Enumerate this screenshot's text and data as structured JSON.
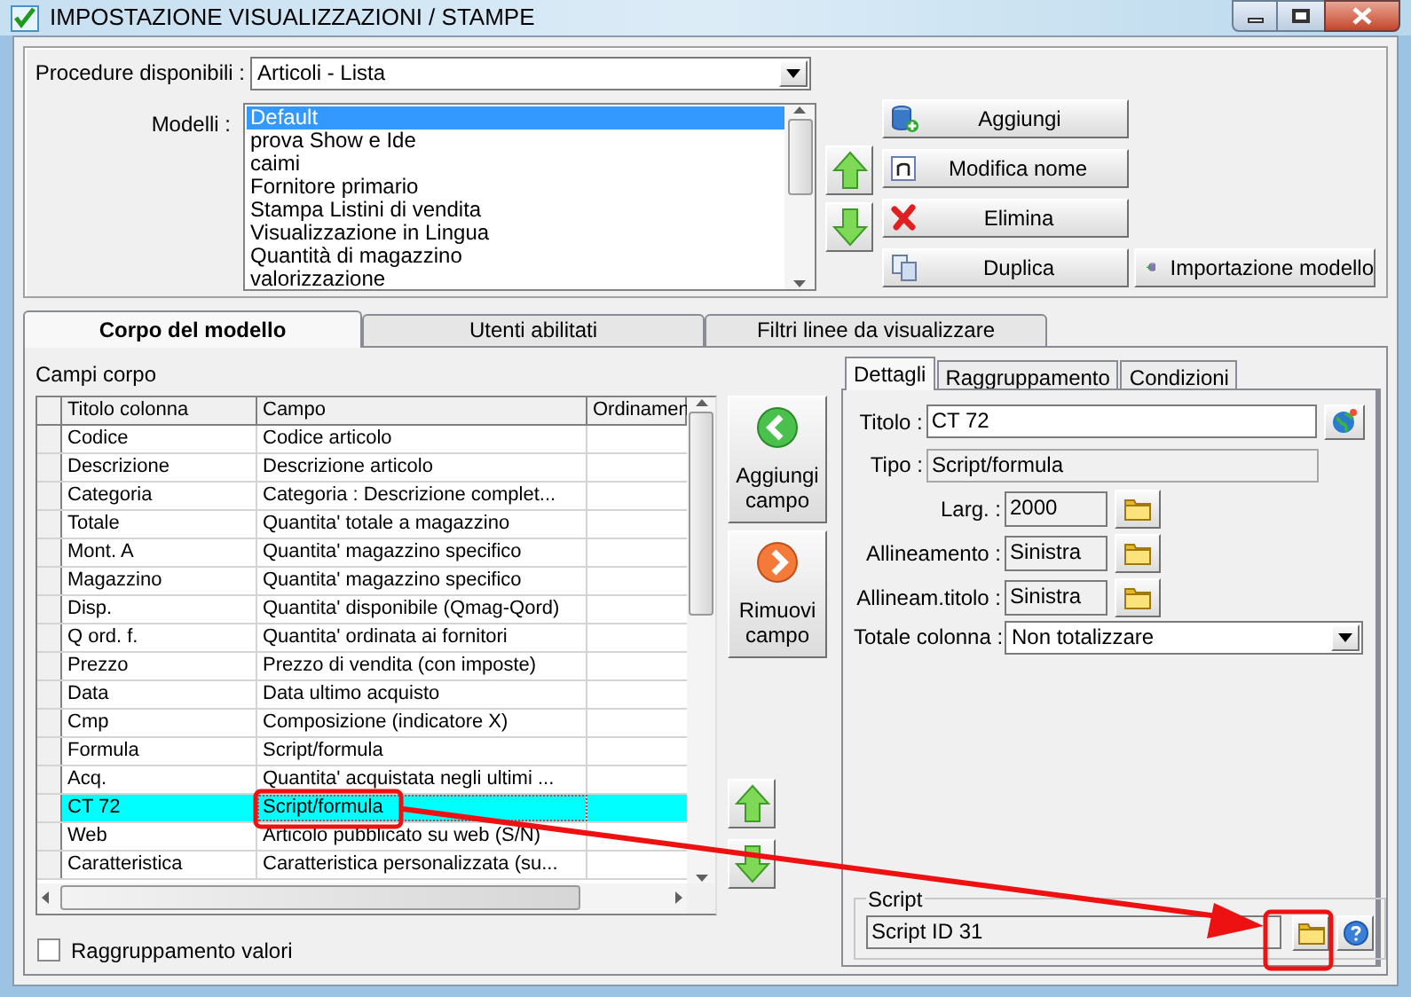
{
  "window": {
    "title": "IMPOSTAZIONE VISUALIZZAZIONI / STAMPE"
  },
  "procedure": {
    "label": "Procedure disponibili :",
    "value": "Articoli - Lista"
  },
  "modelli": {
    "label": "Modelli :",
    "items": [
      {
        "label": "Default",
        "selected": true
      },
      {
        "label": "prova Show e Ide",
        "selected": false
      },
      {
        "label": "caimi",
        "selected": false
      },
      {
        "label": "Fornitore primario",
        "selected": false
      },
      {
        "label": "Stampa Listini di vendita",
        "selected": false
      },
      {
        "label": "Visualizzazione in Lingua",
        "selected": false
      },
      {
        "label": "Quantità di magazzino",
        "selected": false
      },
      {
        "label": "valorizzazione",
        "selected": false
      }
    ]
  },
  "model_buttons": [
    {
      "kind": "add",
      "label": "Aggiungi"
    },
    {
      "kind": "rename",
      "label": "Modifica nome"
    },
    {
      "kind": "delete",
      "label": "Elimina"
    },
    {
      "kind": "duplicate",
      "label": "Duplica"
    }
  ],
  "import_button": {
    "label": "Importazione modello"
  },
  "tabs": [
    {
      "label": "Corpo del modello",
      "selected": true
    },
    {
      "label": "Utenti abilitati",
      "selected": false
    },
    {
      "label": "Filtri linee da visualizzare",
      "selected": false
    }
  ],
  "campi_corpo": {
    "label": "Campi corpo",
    "columns": [
      "Titolo colonna",
      "Campo",
      "Ordinamen"
    ],
    "rows": [
      {
        "titolo": "Codice",
        "campo": "Codice articolo",
        "selected": false
      },
      {
        "titolo": "Descrizione",
        "campo": "Descrizione articolo",
        "selected": false
      },
      {
        "titolo": "Categoria",
        "campo": "Categoria : Descrizione complet...",
        "selected": false
      },
      {
        "titolo": "Totale",
        "campo": "Quantita' totale a magazzino",
        "selected": false
      },
      {
        "titolo": "Mont. A",
        "campo": "Quantita' magazzino specifico",
        "selected": false
      },
      {
        "titolo": "Magazzino",
        "campo": "Quantita' magazzino specifico",
        "selected": false
      },
      {
        "titolo": "Disp.",
        "campo": "Quantita' disponibile (Qmag-Qord)",
        "selected": false
      },
      {
        "titolo": "Q ord. f.",
        "campo": "Quantita' ordinata ai fornitori",
        "selected": false
      },
      {
        "titolo": "Prezzo",
        "campo": "Prezzo di vendita (con imposte)",
        "selected": false
      },
      {
        "titolo": "Data",
        "campo": "Data ultimo acquisto",
        "selected": false
      },
      {
        "titolo": "Cmp",
        "campo": "Composizione (indicatore X)",
        "selected": false
      },
      {
        "titolo": "Formula",
        "campo": "Script/formula",
        "selected": false
      },
      {
        "titolo": "Acq.",
        "campo": "Quantita' acquistata negli ultimi ...",
        "selected": false
      },
      {
        "titolo": "CT 72",
        "campo": "Script/formula",
        "selected": true
      },
      {
        "titolo": "Web",
        "campo": "Articolo pubblicato su web (S/N)",
        "selected": false
      },
      {
        "titolo": "Caratteristica",
        "campo": "Caratteristica personalizzata (su...",
        "selected": false
      }
    ]
  },
  "field_buttons": [
    {
      "kind": "add",
      "label": "Aggiungi campo"
    },
    {
      "kind": "remove",
      "label": "Rimuovi campo"
    }
  ],
  "raggruppamento_valori": {
    "label": "Raggruppamento valori",
    "checked": false
  },
  "detail_tabs": [
    {
      "label": "Dettagli",
      "selected": true
    },
    {
      "label": "Raggruppamento",
      "selected": false
    },
    {
      "label": "Condizioni",
      "selected": false
    }
  ],
  "details": {
    "titolo": {
      "label": "Titolo :",
      "value": "CT 72"
    },
    "tipo": {
      "label": "Tipo :",
      "value": "Script/formula"
    },
    "props": [
      {
        "label": "Larg. :",
        "value": "2000"
      },
      {
        "label": "Allineamento :",
        "value": "Sinistra"
      },
      {
        "label": "Allineam.titolo :",
        "value": "Sinistra"
      }
    ],
    "totale": {
      "label": "Totale colonna :",
      "value": "Non totalizzare"
    }
  },
  "script": {
    "legend": "Script",
    "value": "Script ID 31"
  }
}
